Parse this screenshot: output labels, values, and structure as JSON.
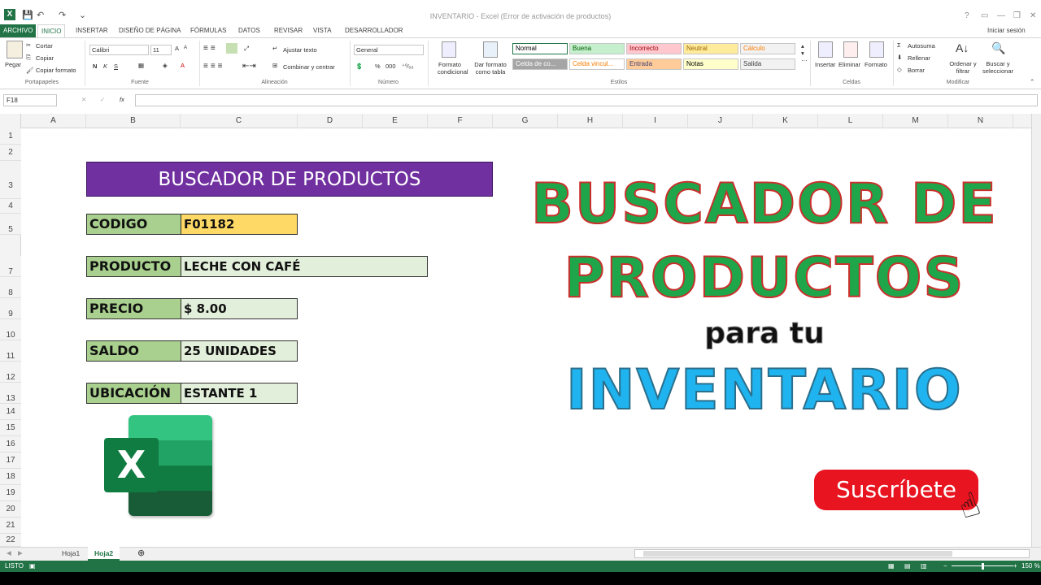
{
  "window": {
    "title": "INVENTARIO - Excel (Error de activación de productos)",
    "controls": [
      "?",
      "▭",
      "—",
      "❐",
      "✕"
    ]
  },
  "ribbon_tabs": [
    {
      "label": "ARCHIVO"
    },
    {
      "label": "INICIO"
    },
    {
      "label": "INSERTAR"
    },
    {
      "label": "DISEÑO DE PÁGINA"
    },
    {
      "label": "FÓRMULAS"
    },
    {
      "label": "DATOS"
    },
    {
      "label": "REVISAR"
    },
    {
      "label": "VISTA"
    },
    {
      "label": "DESARROLLADOR"
    }
  ],
  "signin": "Iniciar sesión",
  "clipboard": {
    "paste": "Pegar",
    "cut": "Cortar",
    "copy": "Copiar",
    "format_painter": "Copiar formato",
    "group": "Portapapeles"
  },
  "font": {
    "name": "Calibri",
    "size": "11",
    "bold": "N",
    "italic": "K",
    "underline": "S",
    "group": "Fuente"
  },
  "alignment": {
    "wrap": "Ajustar texto",
    "merge": "Combinar y centrar",
    "group": "Alineación"
  },
  "number": {
    "format": "General",
    "percent": "%",
    "thousands": "000",
    "group": "Número"
  },
  "styles_group": {
    "conditional": [
      "Formato",
      "condicional"
    ],
    "as_table": [
      "Dar formato",
      "como tabla"
    ],
    "cells": [
      {
        "label": "Normal",
        "bg": "#ffffff",
        "fg": "#000000"
      },
      {
        "label": "Buena",
        "bg": "#c6efce",
        "fg": "#006100"
      },
      {
        "label": "Incorrecto",
        "bg": "#ffc7ce",
        "fg": "#9c0006"
      },
      {
        "label": "Neutral",
        "bg": "#ffeb9c",
        "fg": "#9c6500"
      },
      {
        "label": "Cálculo",
        "bg": "#f2f2f2",
        "fg": "#fa7d00"
      },
      {
        "label": "Celda de co...",
        "bg": "#a5a5a5",
        "fg": "#ffffff"
      },
      {
        "label": "Celda vincul...",
        "bg": "#ffffff",
        "fg": "#fa7d00"
      },
      {
        "label": "Entrada",
        "bg": "#ffcc99",
        "fg": "#3f3f76"
      },
      {
        "label": "Notas",
        "bg": "#ffffcc",
        "fg": "#000000"
      },
      {
        "label": "Salida",
        "bg": "#f2f2f2",
        "fg": "#3f3f3f"
      }
    ],
    "group": "Estilos"
  },
  "cells_group": {
    "insert": "Insertar",
    "delete": "Eliminar",
    "format": "Formato",
    "group": "Celdas"
  },
  "editing": {
    "autosum": "Autosuma",
    "fill": "Rellenar",
    "clear": "Borrar",
    "sort": [
      "Ordenar y",
      "filtrar"
    ],
    "find": [
      "Buscar y",
      "seleccionar"
    ],
    "group": "Modificar"
  },
  "formula_bar": {
    "cell_ref": "F18",
    "cancel": "✕",
    "enter": "✓",
    "fx": "fx",
    "value": ""
  },
  "columns": [
    "A",
    "B",
    "C",
    "D",
    "E",
    "F",
    "G",
    "H",
    "I",
    "J",
    "K",
    "L",
    "M",
    "N"
  ],
  "rows": [
    "1",
    "2",
    "3",
    "4",
    "5",
    "7",
    "8",
    "9",
    "10",
    "11",
    "12",
    "13",
    "14",
    "15",
    "16",
    "17",
    "18",
    "19",
    "20",
    "21",
    "22"
  ],
  "sheet": {
    "banner": "BUSCADOR DE PRODUCTOS",
    "fields": [
      {
        "label": "CODIGO",
        "value": "F01182",
        "value_bg": "#ffd966"
      },
      {
        "label": "PRODUCTO",
        "value": "LECHE CON CAFÉ",
        "value_bg": "#e2efda"
      },
      {
        "label": "PRECIO",
        "value": "$ 8.00",
        "value_bg": "#e2efda"
      },
      {
        "label": "SALDO",
        "value": "25 UNIDADES",
        "value_bg": "#e2efda"
      },
      {
        "label": "UBICACIÓN",
        "value": "ESTANTE 1",
        "value_bg": "#e2efda"
      }
    ],
    "promo": {
      "line1": "BUSCADOR DE",
      "line2": "PRODUCTOS",
      "line3": "para tu",
      "line4": "INVENTARIO"
    },
    "subscribe": "Suscríbete",
    "excel_logo_letter": "X"
  },
  "sheet_tabs": [
    {
      "label": "Hoja1"
    },
    {
      "label": "Hoja2"
    }
  ],
  "add_sheet": "⊕",
  "status": {
    "text": "LISTO",
    "zoom": "150 %"
  }
}
